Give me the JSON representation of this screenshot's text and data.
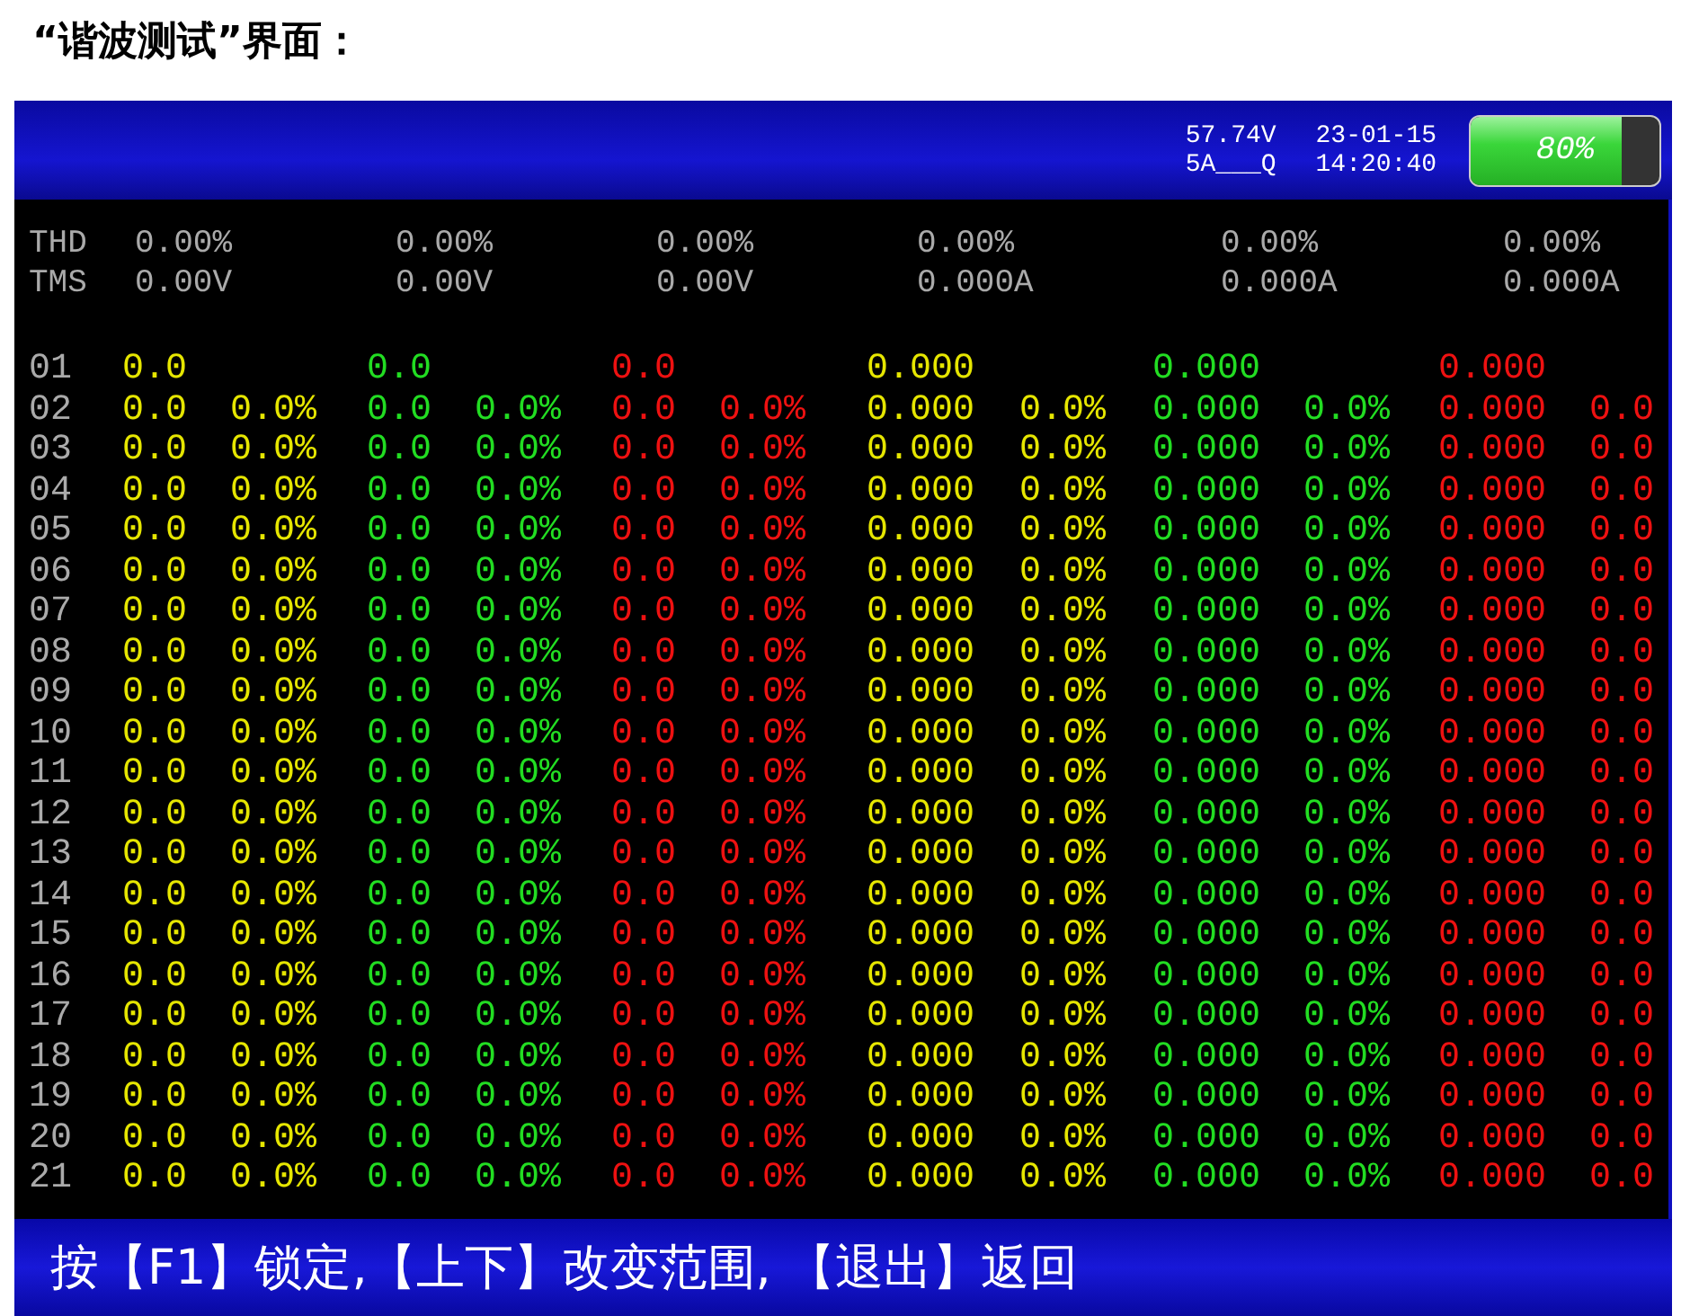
{
  "caption": "“谐波测试”界面：",
  "status": {
    "voltage": "57.74V",
    "date": "23-01-15",
    "range": "5A___Q",
    "time": "14:20:40"
  },
  "battery": {
    "level": 0.8,
    "label": "80%"
  },
  "channels": [
    {
      "color": "#e6e600",
      "thd": "0.00%",
      "rms": "0.00V"
    },
    {
      "color": "#22dd22",
      "thd": "0.00%",
      "rms": "0.00V"
    },
    {
      "color": "#ee1111",
      "thd": "0.00%",
      "rms": "0.00V"
    },
    {
      "color": "#e6e600",
      "thd": "0.00%",
      "rms": "0.000A"
    },
    {
      "color": "#22dd22",
      "thd": "0.00%",
      "rms": "0.000A"
    },
    {
      "color": "#ee1111",
      "thd": "0.00%",
      "rms": "0.000A"
    }
  ],
  "summary_labels": [
    "THD",
    "TMS"
  ],
  "rows": [
    {
      "index": "01",
      "cells": [
        {
          "value": "0.0"
        },
        {
          "value": "0.0"
        },
        {
          "value": "0.0"
        },
        {
          "value": "0.000"
        },
        {
          "value": "0.000"
        },
        {
          "value": "0.000"
        }
      ]
    },
    {
      "index": "02",
      "cells": [
        {
          "value": "0.0",
          "percent": "0.0%"
        },
        {
          "value": "0.0",
          "percent": "0.0%"
        },
        {
          "value": "0.0",
          "percent": "0.0%"
        },
        {
          "value": "0.000",
          "percent": "0.0%"
        },
        {
          "value": "0.000",
          "percent": "0.0%"
        },
        {
          "value": "0.000",
          "percent": "0.0"
        }
      ]
    },
    {
      "index": "03",
      "cells": [
        {
          "value": "0.0",
          "percent": "0.0%"
        },
        {
          "value": "0.0",
          "percent": "0.0%"
        },
        {
          "value": "0.0",
          "percent": "0.0%"
        },
        {
          "value": "0.000",
          "percent": "0.0%"
        },
        {
          "value": "0.000",
          "percent": "0.0%"
        },
        {
          "value": "0.000",
          "percent": "0.0"
        }
      ]
    },
    {
      "index": "04",
      "cells": [
        {
          "value": "0.0",
          "percent": "0.0%"
        },
        {
          "value": "0.0",
          "percent": "0.0%"
        },
        {
          "value": "0.0",
          "percent": "0.0%"
        },
        {
          "value": "0.000",
          "percent": "0.0%"
        },
        {
          "value": "0.000",
          "percent": "0.0%"
        },
        {
          "value": "0.000",
          "percent": "0.0"
        }
      ]
    },
    {
      "index": "05",
      "cells": [
        {
          "value": "0.0",
          "percent": "0.0%"
        },
        {
          "value": "0.0",
          "percent": "0.0%"
        },
        {
          "value": "0.0",
          "percent": "0.0%"
        },
        {
          "value": "0.000",
          "percent": "0.0%"
        },
        {
          "value": "0.000",
          "percent": "0.0%"
        },
        {
          "value": "0.000",
          "percent": "0.0"
        }
      ]
    },
    {
      "index": "06",
      "cells": [
        {
          "value": "0.0",
          "percent": "0.0%"
        },
        {
          "value": "0.0",
          "percent": "0.0%"
        },
        {
          "value": "0.0",
          "percent": "0.0%"
        },
        {
          "value": "0.000",
          "percent": "0.0%"
        },
        {
          "value": "0.000",
          "percent": "0.0%"
        },
        {
          "value": "0.000",
          "percent": "0.0"
        }
      ]
    },
    {
      "index": "07",
      "cells": [
        {
          "value": "0.0",
          "percent": "0.0%"
        },
        {
          "value": "0.0",
          "percent": "0.0%"
        },
        {
          "value": "0.0",
          "percent": "0.0%"
        },
        {
          "value": "0.000",
          "percent": "0.0%"
        },
        {
          "value": "0.000",
          "percent": "0.0%"
        },
        {
          "value": "0.000",
          "percent": "0.0"
        }
      ]
    },
    {
      "index": "08",
      "cells": [
        {
          "value": "0.0",
          "percent": "0.0%"
        },
        {
          "value": "0.0",
          "percent": "0.0%"
        },
        {
          "value": "0.0",
          "percent": "0.0%"
        },
        {
          "value": "0.000",
          "percent": "0.0%"
        },
        {
          "value": "0.000",
          "percent": "0.0%"
        },
        {
          "value": "0.000",
          "percent": "0.0"
        }
      ]
    },
    {
      "index": "09",
      "cells": [
        {
          "value": "0.0",
          "percent": "0.0%"
        },
        {
          "value": "0.0",
          "percent": "0.0%"
        },
        {
          "value": "0.0",
          "percent": "0.0%"
        },
        {
          "value": "0.000",
          "percent": "0.0%"
        },
        {
          "value": "0.000",
          "percent": "0.0%"
        },
        {
          "value": "0.000",
          "percent": "0.0"
        }
      ]
    },
    {
      "index": "10",
      "cells": [
        {
          "value": "0.0",
          "percent": "0.0%"
        },
        {
          "value": "0.0",
          "percent": "0.0%"
        },
        {
          "value": "0.0",
          "percent": "0.0%"
        },
        {
          "value": "0.000",
          "percent": "0.0%"
        },
        {
          "value": "0.000",
          "percent": "0.0%"
        },
        {
          "value": "0.000",
          "percent": "0.0"
        }
      ]
    },
    {
      "index": "11",
      "cells": [
        {
          "value": "0.0",
          "percent": "0.0%"
        },
        {
          "value": "0.0",
          "percent": "0.0%"
        },
        {
          "value": "0.0",
          "percent": "0.0%"
        },
        {
          "value": "0.000",
          "percent": "0.0%"
        },
        {
          "value": "0.000",
          "percent": "0.0%"
        },
        {
          "value": "0.000",
          "percent": "0.0"
        }
      ]
    },
    {
      "index": "12",
      "cells": [
        {
          "value": "0.0",
          "percent": "0.0%"
        },
        {
          "value": "0.0",
          "percent": "0.0%"
        },
        {
          "value": "0.0",
          "percent": "0.0%"
        },
        {
          "value": "0.000",
          "percent": "0.0%"
        },
        {
          "value": "0.000",
          "percent": "0.0%"
        },
        {
          "value": "0.000",
          "percent": "0.0"
        }
      ]
    },
    {
      "index": "13",
      "cells": [
        {
          "value": "0.0",
          "percent": "0.0%"
        },
        {
          "value": "0.0",
          "percent": "0.0%"
        },
        {
          "value": "0.0",
          "percent": "0.0%"
        },
        {
          "value": "0.000",
          "percent": "0.0%"
        },
        {
          "value": "0.000",
          "percent": "0.0%"
        },
        {
          "value": "0.000",
          "percent": "0.0"
        }
      ]
    },
    {
      "index": "14",
      "cells": [
        {
          "value": "0.0",
          "percent": "0.0%"
        },
        {
          "value": "0.0",
          "percent": "0.0%"
        },
        {
          "value": "0.0",
          "percent": "0.0%"
        },
        {
          "value": "0.000",
          "percent": "0.0%"
        },
        {
          "value": "0.000",
          "percent": "0.0%"
        },
        {
          "value": "0.000",
          "percent": "0.0"
        }
      ]
    },
    {
      "index": "15",
      "cells": [
        {
          "value": "0.0",
          "percent": "0.0%"
        },
        {
          "value": "0.0",
          "percent": "0.0%"
        },
        {
          "value": "0.0",
          "percent": "0.0%"
        },
        {
          "value": "0.000",
          "percent": "0.0%"
        },
        {
          "value": "0.000",
          "percent": "0.0%"
        },
        {
          "value": "0.000",
          "percent": "0.0"
        }
      ]
    },
    {
      "index": "16",
      "cells": [
        {
          "value": "0.0",
          "percent": "0.0%"
        },
        {
          "value": "0.0",
          "percent": "0.0%"
        },
        {
          "value": "0.0",
          "percent": "0.0%"
        },
        {
          "value": "0.000",
          "percent": "0.0%"
        },
        {
          "value": "0.000",
          "percent": "0.0%"
        },
        {
          "value": "0.000",
          "percent": "0.0"
        }
      ]
    },
    {
      "index": "17",
      "cells": [
        {
          "value": "0.0",
          "percent": "0.0%"
        },
        {
          "value": "0.0",
          "percent": "0.0%"
        },
        {
          "value": "0.0",
          "percent": "0.0%"
        },
        {
          "value": "0.000",
          "percent": "0.0%"
        },
        {
          "value": "0.000",
          "percent": "0.0%"
        },
        {
          "value": "0.000",
          "percent": "0.0"
        }
      ]
    },
    {
      "index": "18",
      "cells": [
        {
          "value": "0.0",
          "percent": "0.0%"
        },
        {
          "value": "0.0",
          "percent": "0.0%"
        },
        {
          "value": "0.0",
          "percent": "0.0%"
        },
        {
          "value": "0.000",
          "percent": "0.0%"
        },
        {
          "value": "0.000",
          "percent": "0.0%"
        },
        {
          "value": "0.000",
          "percent": "0.0"
        }
      ]
    },
    {
      "index": "19",
      "cells": [
        {
          "value": "0.0",
          "percent": "0.0%"
        },
        {
          "value": "0.0",
          "percent": "0.0%"
        },
        {
          "value": "0.0",
          "percent": "0.0%"
        },
        {
          "value": "0.000",
          "percent": "0.0%"
        },
        {
          "value": "0.000",
          "percent": "0.0%"
        },
        {
          "value": "0.000",
          "percent": "0.0"
        }
      ]
    },
    {
      "index": "20",
      "cells": [
        {
          "value": "0.0",
          "percent": "0.0%"
        },
        {
          "value": "0.0",
          "percent": "0.0%"
        },
        {
          "value": "0.0",
          "percent": "0.0%"
        },
        {
          "value": "0.000",
          "percent": "0.0%"
        },
        {
          "value": "0.000",
          "percent": "0.0%"
        },
        {
          "value": "0.000",
          "percent": "0.0"
        }
      ]
    },
    {
      "index": "21",
      "cells": [
        {
          "value": "0.0",
          "percent": "0.0%"
        },
        {
          "value": "0.0",
          "percent": "0.0%"
        },
        {
          "value": "0.0",
          "percent": "0.0%"
        },
        {
          "value": "0.000",
          "percent": "0.0%"
        },
        {
          "value": "0.000",
          "percent": "0.0%"
        },
        {
          "value": "0.000",
          "percent": "0.0"
        }
      ]
    }
  ],
  "footer": "按【F1】锁定,【上下】改变范围, 【退出】返回"
}
